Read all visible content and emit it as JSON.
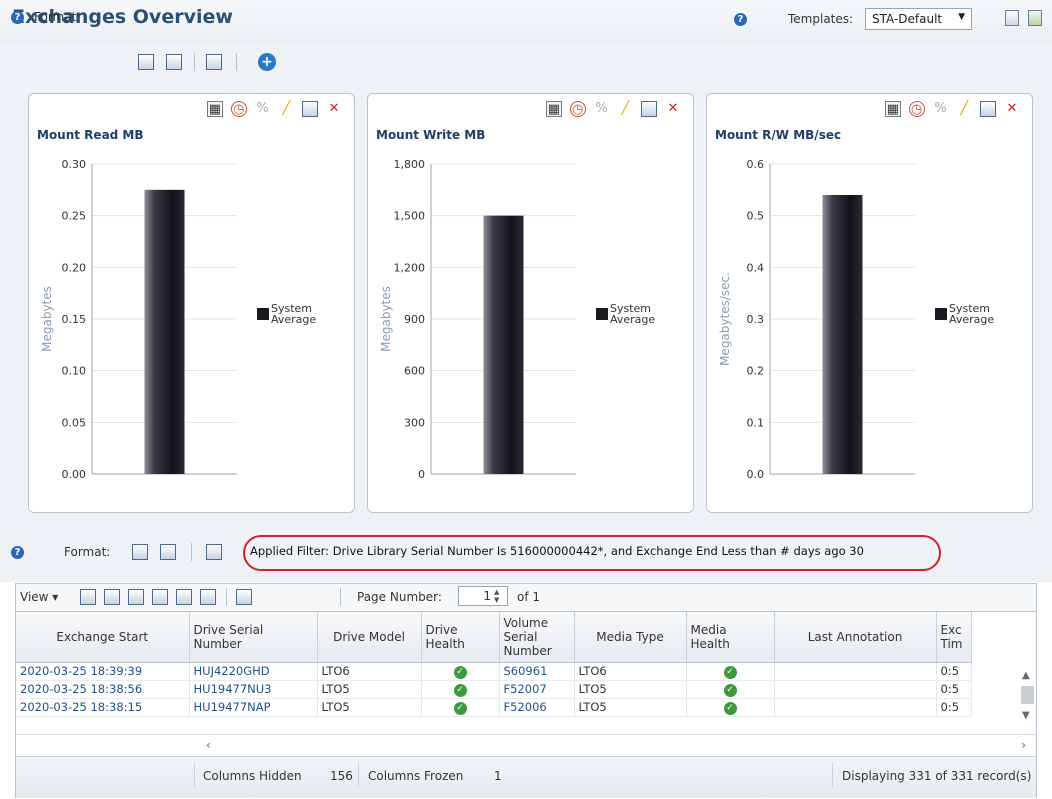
{
  "header": {
    "title": "Exchanges Overview",
    "templates_label": "Templates:",
    "template_value": "STA-Default"
  },
  "format_bar": {
    "label": "Format:"
  },
  "charts": [
    {
      "title": "Mount Read MB"
    },
    {
      "title": "Mount Write MB"
    },
    {
      "title": "Mount R/W MB/sec"
    }
  ],
  "chart_data": [
    {
      "type": "bar",
      "title": "Mount Read MB",
      "ylabel": "Megabytes",
      "yticks": [
        "0.00",
        "0.05",
        "0.10",
        "0.15",
        "0.20",
        "0.25",
        "0.30"
      ],
      "ylim": [
        0,
        0.3
      ],
      "series": [
        {
          "name": "System Average",
          "values": [
            0.275
          ]
        }
      ]
    },
    {
      "type": "bar",
      "title": "Mount Write MB",
      "ylabel": "Megabytes",
      "yticks": [
        "0",
        "300",
        "600",
        "900",
        "1,200",
        "1,500",
        "1,800"
      ],
      "ylim": [
        0,
        1800
      ],
      "series": [
        {
          "name": "System Average",
          "values": [
            1500
          ]
        }
      ]
    },
    {
      "type": "bar",
      "title": "Mount R/W MB/sec",
      "ylabel": "Megabytes/sec.",
      "yticks": [
        "0.0",
        "0.1",
        "0.2",
        "0.3",
        "0.4",
        "0.5",
        "0.6"
      ],
      "ylim": [
        0,
        0.6
      ],
      "series": [
        {
          "name": "System Average",
          "values": [
            0.54
          ]
        }
      ]
    }
  ],
  "filter": {
    "format_label": "Format:",
    "text": "Applied Filter: Drive Library Serial Number Is 516000000442*, and Exchange End Less than # days ago 30"
  },
  "table_toolbar": {
    "view_label": "View",
    "page_number_label": "Page Number:",
    "page_number": "1",
    "page_of": "of 1"
  },
  "table": {
    "columns": [
      "Exchange Start",
      "Drive Serial Number",
      "Drive Model",
      "Drive Health",
      "Volume Serial Number",
      "Media Type",
      "Media Health",
      "Last Annotation",
      "Exc Tim"
    ],
    "rows": [
      [
        "2020-03-25 18:39:39",
        "HUJ4220GHD",
        "LTO6",
        "ok",
        "S60961",
        "LTO6",
        "ok",
        "",
        "0:5"
      ],
      [
        "2020-03-25 18:38:56",
        "HU19477NU3",
        "LTO5",
        "ok",
        "F52007",
        "LTO5",
        "ok",
        "",
        "0:5"
      ],
      [
        "2020-03-25 18:38:15",
        "HU19477NAP",
        "LTO5",
        "ok",
        "F52006",
        "LTO5",
        "ok",
        "",
        "0:5"
      ]
    ]
  },
  "status": {
    "columns_hidden_label": "Columns Hidden",
    "columns_hidden": "156",
    "columns_frozen_label": "Columns Frozen",
    "columns_frozen": "1",
    "records": "Displaying 331 of 331 record(s)"
  }
}
